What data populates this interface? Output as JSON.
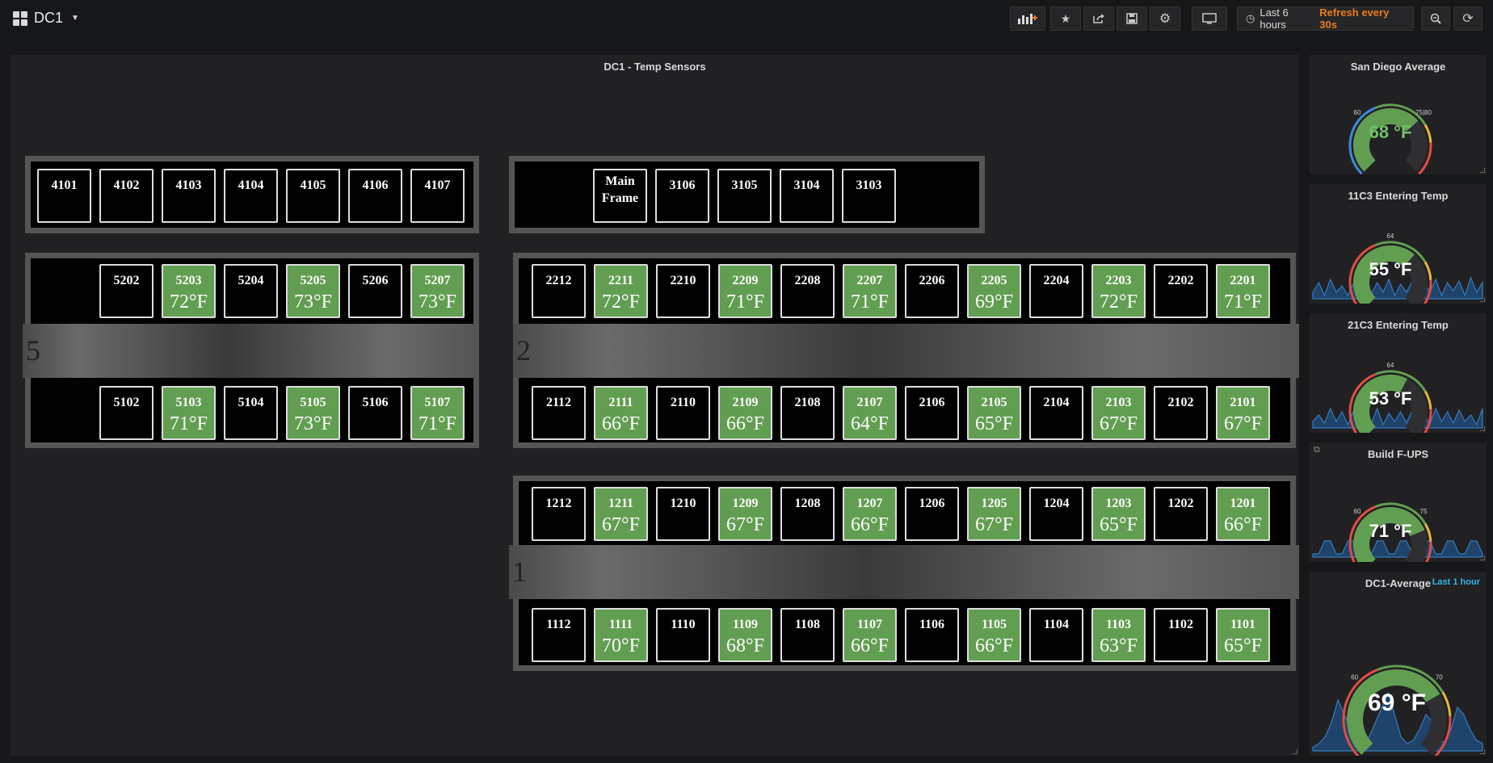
{
  "nav": {
    "title": "DC1",
    "time_range": "Last 6 hours",
    "refresh": "Refresh every 30s",
    "icons": [
      "add-panel-icon",
      "star-icon",
      "share-icon",
      "save-icon",
      "settings-icon",
      "tv-mode-icon",
      "clock-icon",
      "zoom-out-icon",
      "refresh-icon"
    ]
  },
  "main_panel": {
    "title": "DC1 - Temp Sensors",
    "rows": {
      "r41": [
        {
          "id": "4101",
          "temp": null
        },
        {
          "id": "4102",
          "temp": null
        },
        {
          "id": "4103",
          "temp": null
        },
        {
          "id": "4104",
          "temp": null
        },
        {
          "id": "4105",
          "temp": null
        },
        {
          "id": "4106",
          "temp": null
        },
        {
          "id": "4107",
          "temp": null
        }
      ],
      "r31": [
        {
          "id": "Main Frame",
          "temp": null
        },
        {
          "id": "3106",
          "temp": null
        },
        {
          "id": "3105",
          "temp": null
        },
        {
          "id": "3104",
          "temp": null
        },
        {
          "id": "3103",
          "temp": null
        }
      ],
      "r52": [
        {
          "id": "5202",
          "temp": null
        },
        {
          "id": "5203",
          "temp": "72°F"
        },
        {
          "id": "5204",
          "temp": null
        },
        {
          "id": "5205",
          "temp": "73°F"
        },
        {
          "id": "5206",
          "temp": null
        },
        {
          "id": "5207",
          "temp": "73°F"
        }
      ],
      "r51": [
        {
          "id": "5102",
          "temp": null
        },
        {
          "id": "5103",
          "temp": "71°F"
        },
        {
          "id": "5104",
          "temp": null
        },
        {
          "id": "5105",
          "temp": "73°F"
        },
        {
          "id": "5106",
          "temp": null
        },
        {
          "id": "5107",
          "temp": "71°F"
        }
      ],
      "r22": [
        {
          "id": "2212",
          "temp": null
        },
        {
          "id": "2211",
          "temp": "72°F"
        },
        {
          "id": "2210",
          "temp": null
        },
        {
          "id": "2209",
          "temp": "71°F"
        },
        {
          "id": "2208",
          "temp": null
        },
        {
          "id": "2207",
          "temp": "71°F"
        },
        {
          "id": "2206",
          "temp": null
        },
        {
          "id": "2205",
          "temp": "69°F"
        },
        {
          "id": "2204",
          "temp": null
        },
        {
          "id": "2203",
          "temp": "72°F"
        },
        {
          "id": "2202",
          "temp": null
        },
        {
          "id": "2201",
          "temp": "71°F"
        }
      ],
      "r21": [
        {
          "id": "2112",
          "temp": null
        },
        {
          "id": "2111",
          "temp": "66°F"
        },
        {
          "id": "2110",
          "temp": null
        },
        {
          "id": "2109",
          "temp": "66°F"
        },
        {
          "id": "2108",
          "temp": null
        },
        {
          "id": "2107",
          "temp": "64°F"
        },
        {
          "id": "2106",
          "temp": null
        },
        {
          "id": "2105",
          "temp": "65°F"
        },
        {
          "id": "2104",
          "temp": null
        },
        {
          "id": "2103",
          "temp": "67°F"
        },
        {
          "id": "2102",
          "temp": null
        },
        {
          "id": "2101",
          "temp": "67°F"
        }
      ],
      "r12": [
        {
          "id": "1212",
          "temp": null
        },
        {
          "id": "1211",
          "temp": "67°F"
        },
        {
          "id": "1210",
          "temp": null
        },
        {
          "id": "1209",
          "temp": "67°F"
        },
        {
          "id": "1208",
          "temp": null
        },
        {
          "id": "1207",
          "temp": "66°F"
        },
        {
          "id": "1206",
          "temp": null
        },
        {
          "id": "1205",
          "temp": "67°F"
        },
        {
          "id": "1204",
          "temp": null
        },
        {
          "id": "1203",
          "temp": "65°F"
        },
        {
          "id": "1202",
          "temp": null
        },
        {
          "id": "1201",
          "temp": "66°F"
        }
      ],
      "r11": [
        {
          "id": "1112",
          "temp": null
        },
        {
          "id": "1111",
          "temp": "70°F"
        },
        {
          "id": "1110",
          "temp": null
        },
        {
          "id": "1109",
          "temp": "68°F"
        },
        {
          "id": "1108",
          "temp": null
        },
        {
          "id": "1107",
          "temp": "66°F"
        },
        {
          "id": "1106",
          "temp": null
        },
        {
          "id": "1105",
          "temp": "66°F"
        },
        {
          "id": "1104",
          "temp": null
        },
        {
          "id": "1103",
          "temp": "63°F"
        },
        {
          "id": "1102",
          "temp": null
        },
        {
          "id": "1101",
          "temp": "65°F"
        }
      ]
    },
    "aisle_labels": {
      "a5": "5",
      "a2": "2",
      "a1": "1"
    }
  },
  "gauges": [
    {
      "title": "San Diego Average",
      "value": "68 °F",
      "value_color": "#73bf69",
      "fill": 0.68,
      "thresholds": [
        "0",
        "60",
        "75|80",
        "100"
      ],
      "sparkline": false
    },
    {
      "title": "11C3 Entering Temp",
      "value": "55 °F",
      "value_color": "#ffffff",
      "fill": 0.65,
      "thresholds": [
        "38",
        "64",
        "80"
      ],
      "sparkline": true
    },
    {
      "title": "21C3 Entering Temp",
      "value": "53 °F",
      "value_color": "#ffffff",
      "fill": 0.6,
      "thresholds": [
        "38",
        "64",
        "80"
      ],
      "sparkline": true
    },
    {
      "title": "Build F-UPS",
      "value": "71 °F",
      "value_color": "#ffffff",
      "fill": 0.75,
      "thresholds": [
        "0",
        "60",
        "75",
        "80"
      ],
      "sparkline": true
    },
    {
      "title": "DC1-Average",
      "value": "69 °F",
      "value_color": "#ffffff",
      "fill": 0.72,
      "thresholds": [
        "0",
        "60",
        "70",
        "80"
      ],
      "sparkline": true,
      "time_override": "Last 1 hour"
    }
  ],
  "colors": {
    "ok": "#629e51",
    "warn": "#eab839",
    "crit": "#e24d42",
    "bg": "#212124"
  }
}
